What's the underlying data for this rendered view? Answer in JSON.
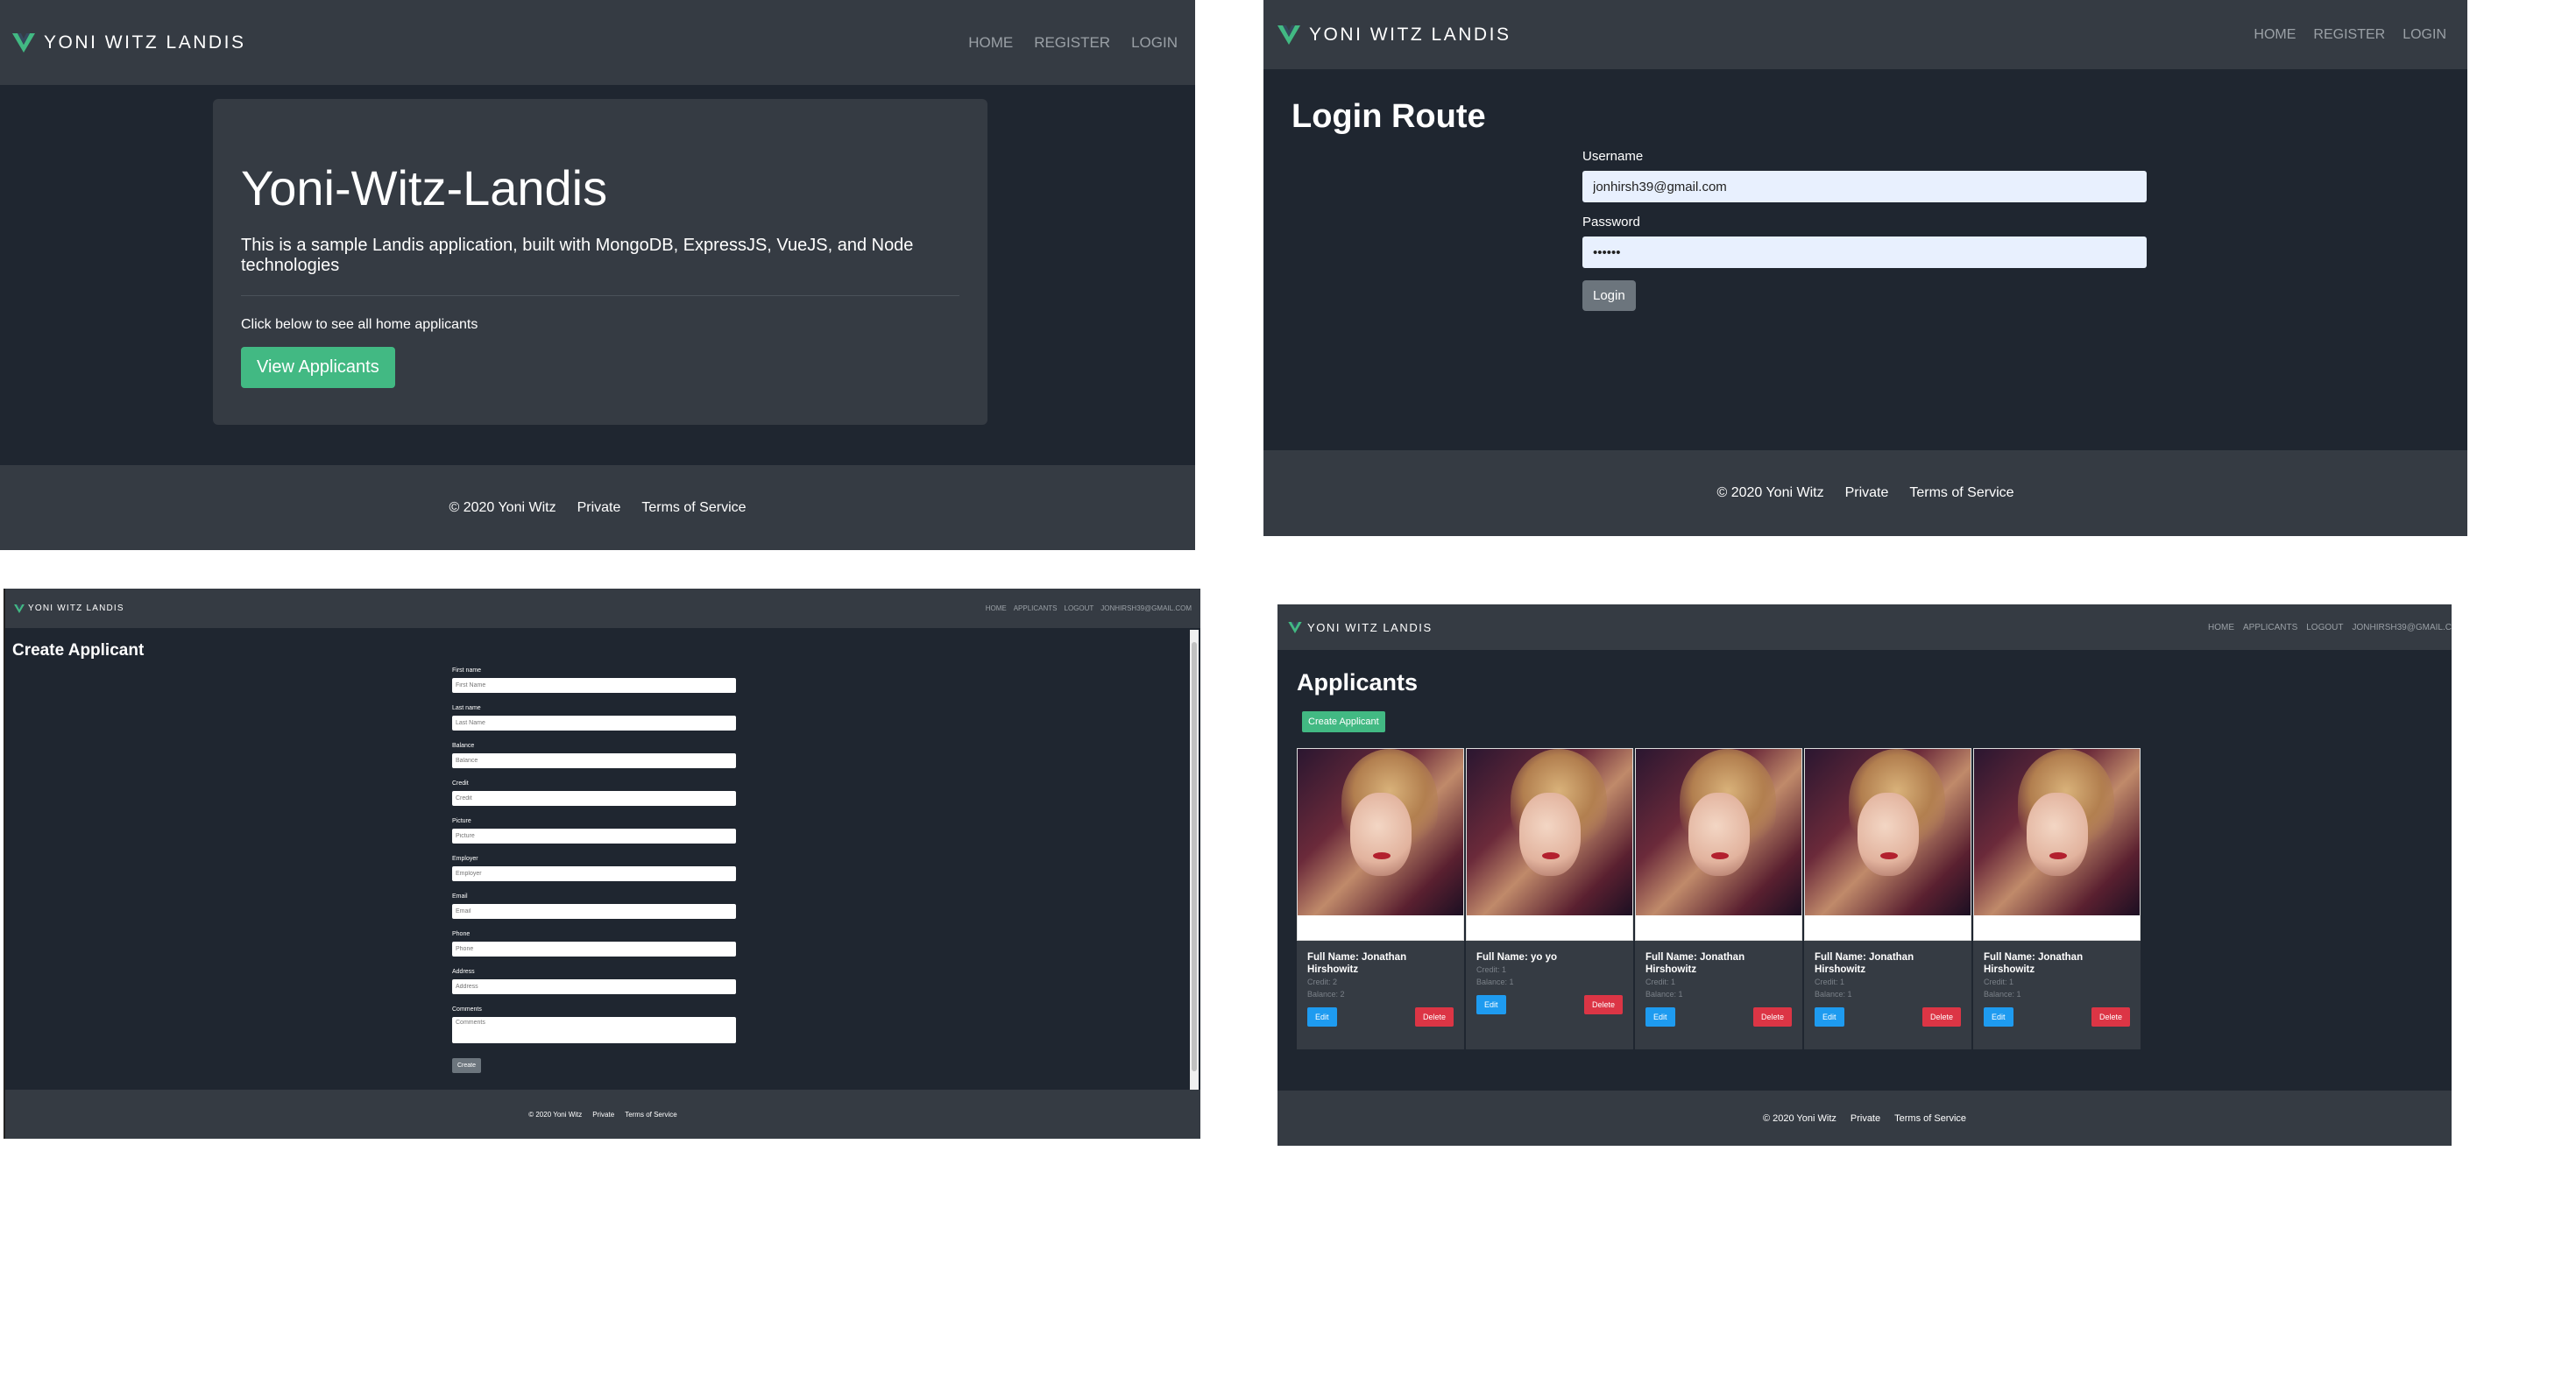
{
  "brand": {
    "name": "YONI WITZ LANDIS",
    "logo_color": "#42b983"
  },
  "colors": {
    "accent": "#42b983",
    "navbar": "#353b43",
    "background": "#1f2630",
    "danger": "#dc3545",
    "info": "#1e9bf0"
  },
  "footer": {
    "copyright": "© 2020 Yoni Witz",
    "private": "Private",
    "terms": "Terms of Service"
  },
  "home": {
    "nav": [
      "HOME",
      "REGISTER",
      "LOGIN"
    ],
    "title": "Yoni-Witz-Landis",
    "lead": "This is a sample Landis application, built with MongoDB, ExpressJS, VueJS, and Node technologies",
    "prompt": "Click below to see all home applicants",
    "button": "View Applicants"
  },
  "login": {
    "nav": [
      "HOME",
      "REGISTER",
      "LOGIN"
    ],
    "title": "Login Route",
    "username_label": "Username",
    "username_value": "jonhirsh39@gmail.com",
    "password_label": "Password",
    "password_value": "••••••",
    "button": "Login"
  },
  "create": {
    "nav": [
      "HOME",
      "APPLICANTS",
      "LOGOUT",
      "JONHIRSH39@GMAIL.COM"
    ],
    "title": "Create Applicant",
    "fields": [
      {
        "label": "First name",
        "placeholder": "First Name"
      },
      {
        "label": "Last name",
        "placeholder": "Last Name"
      },
      {
        "label": "Balance",
        "placeholder": "Balance"
      },
      {
        "label": "Credit",
        "placeholder": "Credit"
      },
      {
        "label": "Picture",
        "placeholder": "Picture"
      },
      {
        "label": "Employer",
        "placeholder": "Employer"
      },
      {
        "label": "Email",
        "placeholder": "Email"
      },
      {
        "label": "Phone",
        "placeholder": "Phone"
      },
      {
        "label": "Address",
        "placeholder": "Address"
      }
    ],
    "comments_label": "Comments",
    "comments_placeholder": "Comments",
    "button": "Create"
  },
  "applicants": {
    "nav": [
      "HOME",
      "APPLICANTS",
      "LOGOUT",
      "JONHIRSH39@GMAIL.C"
    ],
    "title": "Applicants",
    "create_button": "Create Applicant",
    "cards": [
      {
        "name": "Full Name: Jonathan Hirshowitz",
        "credit": "Credit: 2",
        "balance": "Balance: 2",
        "edit": "Edit",
        "delete": "Delete"
      },
      {
        "name": "Full Name: yo yo",
        "credit": "Credit: 1",
        "balance": "Balance: 1",
        "edit": "Edit",
        "delete": "Delete"
      },
      {
        "name": "Full Name: Jonathan Hirshowitz",
        "credit": "Credit: 1",
        "balance": "Balance: 1",
        "edit": "Edit",
        "delete": "Delete"
      },
      {
        "name": "Full Name: Jonathan Hirshowitz",
        "credit": "Credit: 1",
        "balance": "Balance: 1",
        "edit": "Edit",
        "delete": "Delete"
      },
      {
        "name": "Full Name: Jonathan Hirshowitz",
        "credit": "Credit: 1",
        "balance": "Balance: 1",
        "edit": "Edit",
        "delete": "Delete"
      }
    ]
  }
}
